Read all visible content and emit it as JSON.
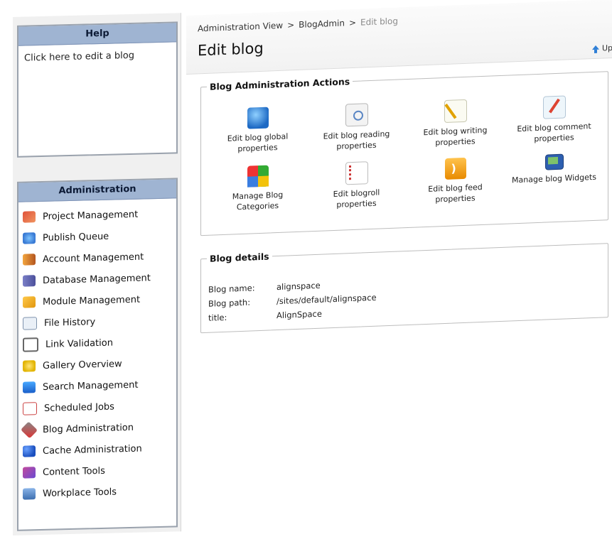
{
  "help": {
    "title": "Help",
    "text": "Click here to edit a blog"
  },
  "admin": {
    "title": "Administration",
    "items": [
      {
        "label": "Project Management",
        "icon": "project-management-icon"
      },
      {
        "label": "Publish Queue",
        "icon": "publish-queue-icon"
      },
      {
        "label": "Account Management",
        "icon": "account-management-icon"
      },
      {
        "label": "Database Management",
        "icon": "database-management-icon"
      },
      {
        "label": "Module Management",
        "icon": "module-management-icon"
      },
      {
        "label": "File History",
        "icon": "file-history-icon"
      },
      {
        "label": "Link Validation",
        "icon": "link-validation-icon"
      },
      {
        "label": "Gallery Overview",
        "icon": "gallery-overview-icon"
      },
      {
        "label": "Search Management",
        "icon": "search-management-icon"
      },
      {
        "label": "Scheduled Jobs",
        "icon": "scheduled-jobs-icon"
      },
      {
        "label": "Blog Administration",
        "icon": "blog-administration-icon"
      },
      {
        "label": "Cache Administration",
        "icon": "cache-administration-icon"
      },
      {
        "label": "Content Tools",
        "icon": "content-tools-icon"
      },
      {
        "label": "Workplace Tools",
        "icon": "workplace-tools-icon"
      }
    ]
  },
  "breadcrumb": {
    "items": [
      "Administration View",
      "BlogAdmin",
      "Edit blog"
    ],
    "separator": ">"
  },
  "page": {
    "title": "Edit blog",
    "up_label": "Up"
  },
  "actions": {
    "legend": "Blog Administration Actions",
    "items": [
      {
        "line1": "Edit blog global",
        "line2": "properties",
        "icon": "globe-icon"
      },
      {
        "line1": "Edit blog reading",
        "line2": "properties",
        "icon": "document-magnifier-icon"
      },
      {
        "line1": "Edit blog writing",
        "line2": "properties",
        "icon": "document-pen-icon"
      },
      {
        "line1": "Edit blog comment",
        "line2": "properties",
        "icon": "comment-pen-icon"
      },
      {
        "line1": "Manage Blog",
        "line2": "Categories",
        "icon": "categories-icon"
      },
      {
        "line1": "Edit blogroll",
        "line2": "properties",
        "icon": "blogroll-icon"
      },
      {
        "line1": "Edit blog feed",
        "line2": "properties",
        "icon": "rss-feed-icon"
      },
      {
        "line1": "Manage blog Widgets",
        "line2": "",
        "icon": "widgets-icon"
      }
    ]
  },
  "details": {
    "legend": "Blog details",
    "rows": [
      {
        "key": "Blog name:",
        "value": "alignspace"
      },
      {
        "key": "Blog path:",
        "value": "/sites/default/alignspace"
      },
      {
        "key": "title:",
        "value": "AlignSpace"
      }
    ]
  },
  "colors": {
    "panel_header": "#9fb4d2",
    "panel_border": "#9aa2ad",
    "accent_blue": "#2f7fd6"
  }
}
